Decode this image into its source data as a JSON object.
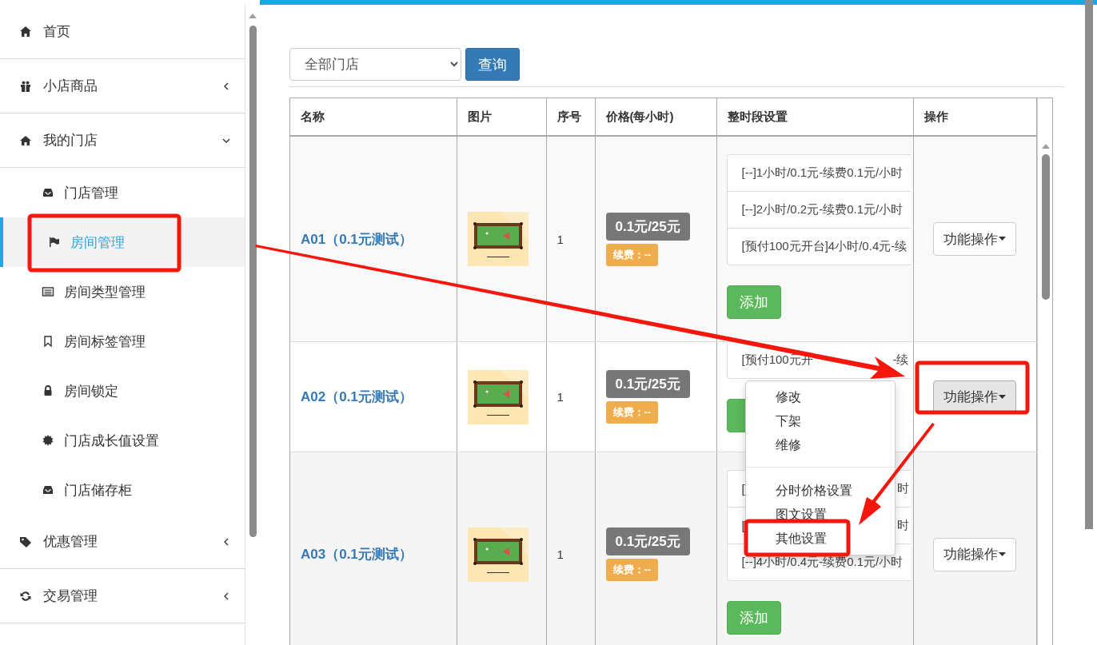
{
  "sidebar": {
    "items": [
      {
        "label": "首页",
        "has_children": false
      },
      {
        "label": "小店商品",
        "expanded": false,
        "has_children": true
      },
      {
        "label": "我的门店",
        "expanded": true,
        "has_children": true,
        "children": [
          {
            "label": "门店管理",
            "selected": false
          },
          {
            "label": "房间管理",
            "selected": true
          },
          {
            "label": "房间类型管理",
            "selected": false
          },
          {
            "label": "房间标签管理",
            "selected": false
          },
          {
            "label": "房间锁定",
            "selected": false
          },
          {
            "label": "门店成长值设置",
            "selected": false
          },
          {
            "label": "门店储存柜",
            "selected": false
          }
        ]
      },
      {
        "label": "优惠管理",
        "expanded": false,
        "has_children": true
      },
      {
        "label": "交易管理",
        "expanded": false,
        "has_children": true
      }
    ]
  },
  "filter": {
    "store_select": "全部门店",
    "query_button": "查询"
  },
  "table": {
    "columns": [
      "名称",
      "图片",
      "序号",
      "价格(每小时)",
      "整时段设置",
      "操作"
    ],
    "rows": [
      {
        "name": "A01（0.1元测试）",
        "seq": "1",
        "price": "0.1元/25元",
        "renewal": "续费：--",
        "slots": [
          {
            "text": "[--]1小时/0.1元-续费0.1元/小时"
          },
          {
            "text": "[--]2小时/0.2元-续费0.1元/小时"
          },
          {
            "text": "[预付100元开台]4小时/0.4元-续"
          }
        ],
        "add_button": "添加",
        "action": "功能操作",
        "expanded": false
      },
      {
        "name": "A02（0.1元测试）",
        "seq": "1",
        "price": "0.1元/25元",
        "renewal": "续费：--",
        "slots": [
          {
            "text": "[预付100元开",
            "tail": "-续"
          }
        ],
        "action": "功能操作",
        "expanded": true,
        "menu": [
          {
            "items": [
              "修改",
              "下架",
              "维修"
            ]
          },
          {
            "items": [
              "分时价格设置",
              "图文设置",
              "其他设置"
            ]
          }
        ]
      },
      {
        "name": "A03（0.1元测试）",
        "seq": "1",
        "price": "0.1元/25元",
        "renewal": "续费：--",
        "slots": [
          {
            "text": "[",
            "tail": "时"
          },
          {
            "text": "[",
            "tail": "时"
          },
          {
            "text": "[--]4小时/0.4元-续费0.1元/小时"
          }
        ],
        "add_button": "添加",
        "action": "功能操作",
        "expanded": false
      }
    ]
  }
}
